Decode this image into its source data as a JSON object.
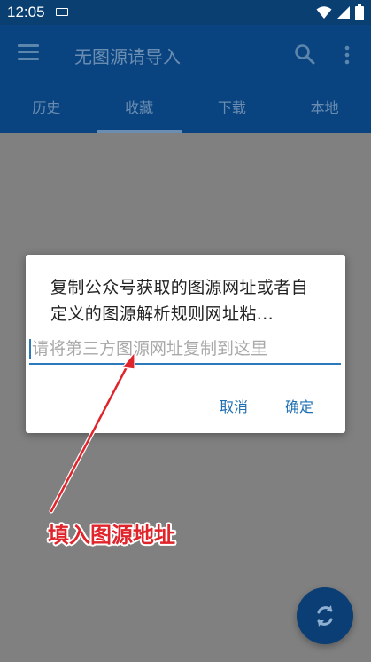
{
  "status_bar": {
    "time": "12:05"
  },
  "app_bar": {
    "title": "无图源请导入"
  },
  "tabs": [
    {
      "label": "历史"
    },
    {
      "label": "收藏"
    },
    {
      "label": "下载"
    },
    {
      "label": "本地"
    }
  ],
  "active_tab": "收藏",
  "dialog": {
    "message": "复制公众号获取的图源网址或者自定义的图源解析规则网址粘...",
    "input_placeholder": "请将第三方图源网址复制到这里",
    "input_value": "",
    "cancel_label": "取消",
    "ok_label": "确定"
  },
  "annotation": {
    "label": "填入图源地址",
    "color": "#e0242b"
  },
  "colors": {
    "primary": "#0a4480",
    "accent": "#2e79b9",
    "status_bar": "#0a3f72"
  },
  "icons": [
    "menu-icon",
    "search-icon",
    "more-vert-icon",
    "keyboard-icon",
    "wifi-icon",
    "signal-icon",
    "battery-icon",
    "refresh-icon"
  ]
}
